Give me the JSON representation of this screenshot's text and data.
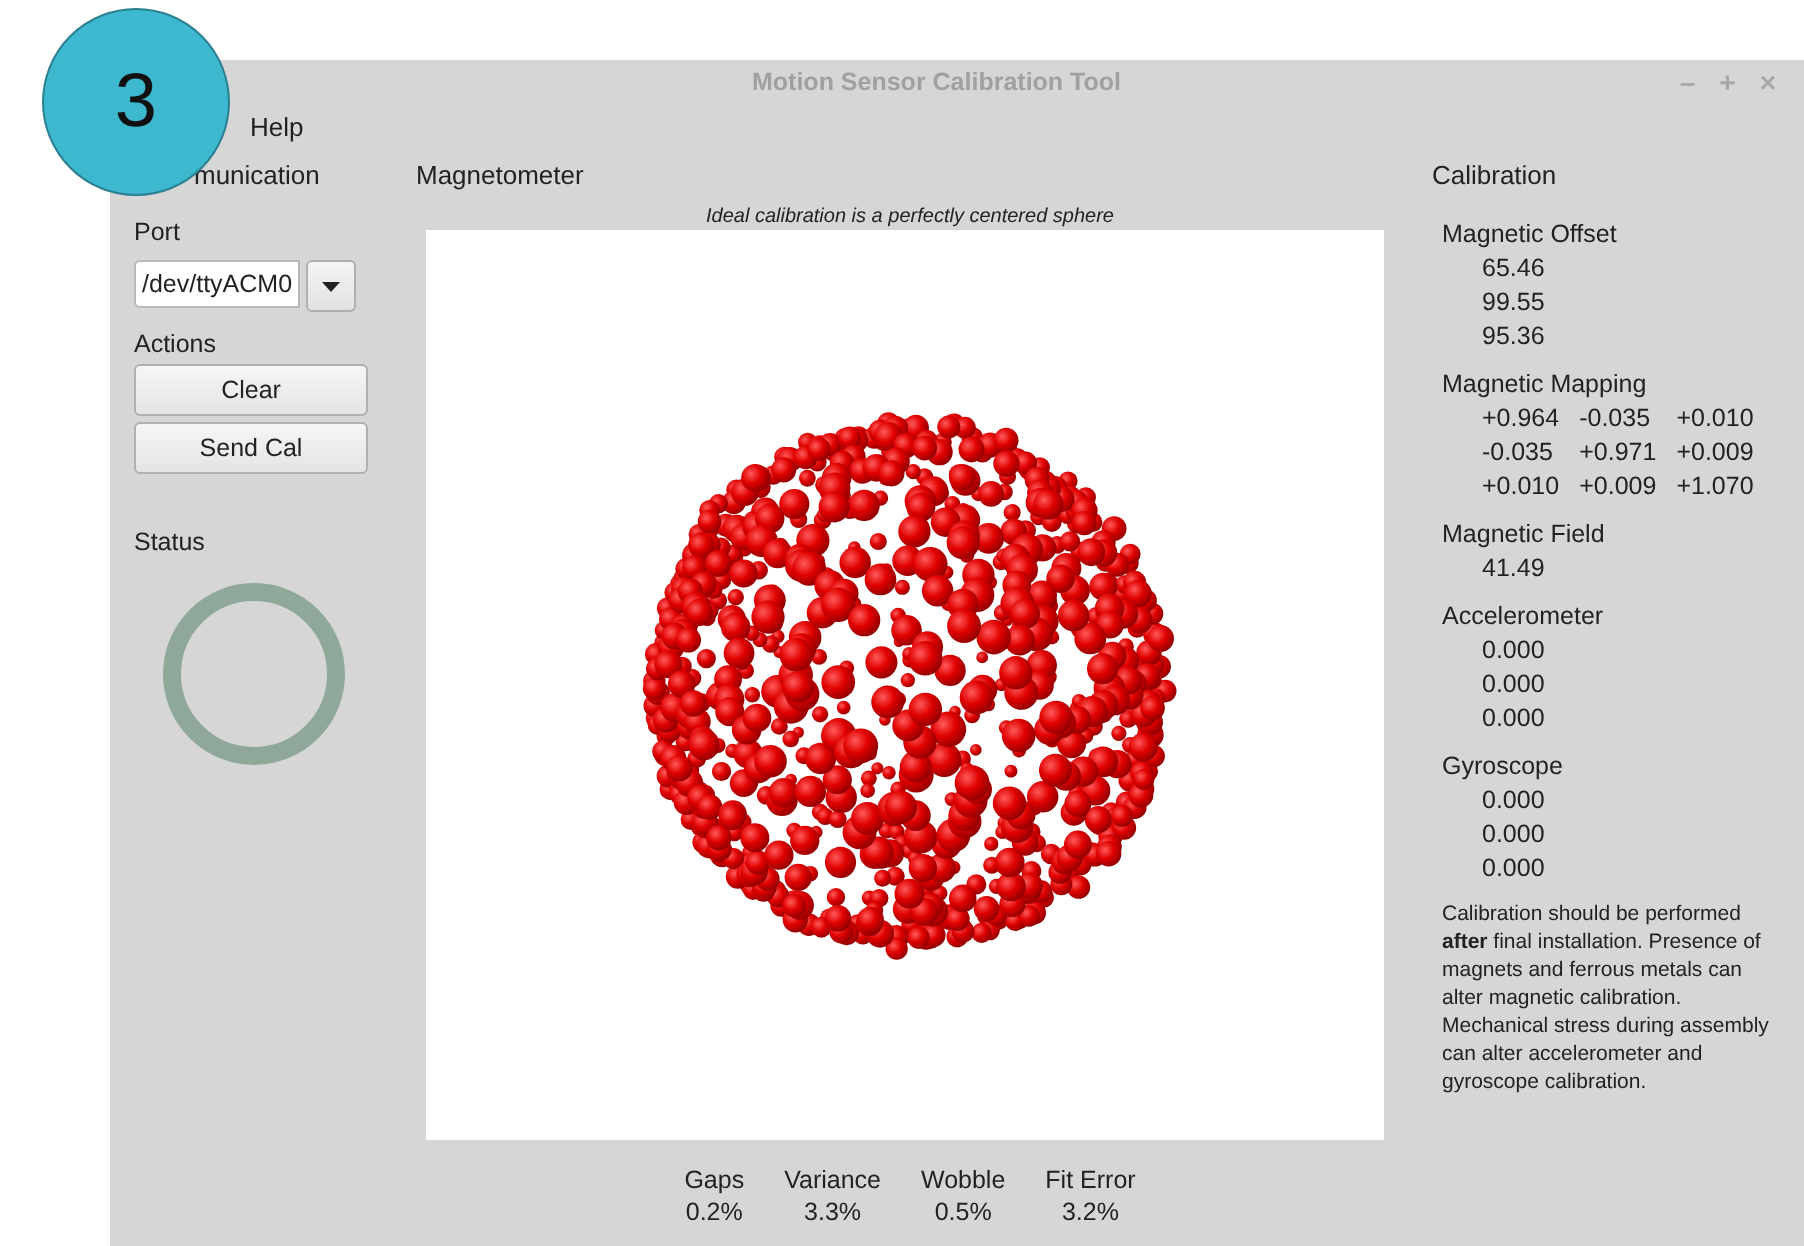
{
  "step_badge": "3",
  "window": {
    "title": "Motion Sensor Calibration Tool",
    "controls": [
      "–",
      "+",
      "×"
    ]
  },
  "menu": [
    "Help"
  ],
  "communication": {
    "heading": "munication",
    "port_label": "Port",
    "port_value": "/dev/ttyACM0",
    "actions_label": "Actions",
    "buttons": [
      "Clear",
      "Send Cal"
    ],
    "status_label": "Status"
  },
  "magnetometer": {
    "heading": "Magnetometer",
    "caption": "Ideal calibration is a perfectly centered sphere",
    "stats": [
      {
        "label": "Gaps",
        "value": "0.2%"
      },
      {
        "label": "Variance",
        "value": "3.3%"
      },
      {
        "label": "Wobble",
        "value": "0.5%"
      },
      {
        "label": "Fit Error",
        "value": "3.2%"
      }
    ]
  },
  "calibration": {
    "heading": "Calibration",
    "sections": [
      {
        "title": "Magnetic Offset",
        "kind": "column",
        "values": [
          "65.46",
          "99.55",
          "95.36"
        ]
      },
      {
        "title": "Magnetic Mapping",
        "kind": "matrix",
        "rows": [
          [
            "+0.964",
            "-0.035",
            "+0.010"
          ],
          [
            "-0.035",
            "+0.971",
            "+0.009"
          ],
          [
            "+0.010",
            "+0.009",
            "+1.070"
          ]
        ]
      },
      {
        "title": "Magnetic Field",
        "kind": "column",
        "values": [
          "41.49"
        ]
      },
      {
        "title": "Accelerometer",
        "kind": "column",
        "values": [
          "0.000",
          "0.000",
          "0.000"
        ]
      },
      {
        "title": "Gyroscope",
        "kind": "column",
        "values": [
          "0.000",
          "0.000",
          "0.000"
        ]
      }
    ],
    "note": "Calibration should be performed **after** final installation.  Presence of magnets and ferrous metals can alter magnetic calibration. Mechanical stress during assembly can alter accelerometer and gyroscope calibration."
  }
}
